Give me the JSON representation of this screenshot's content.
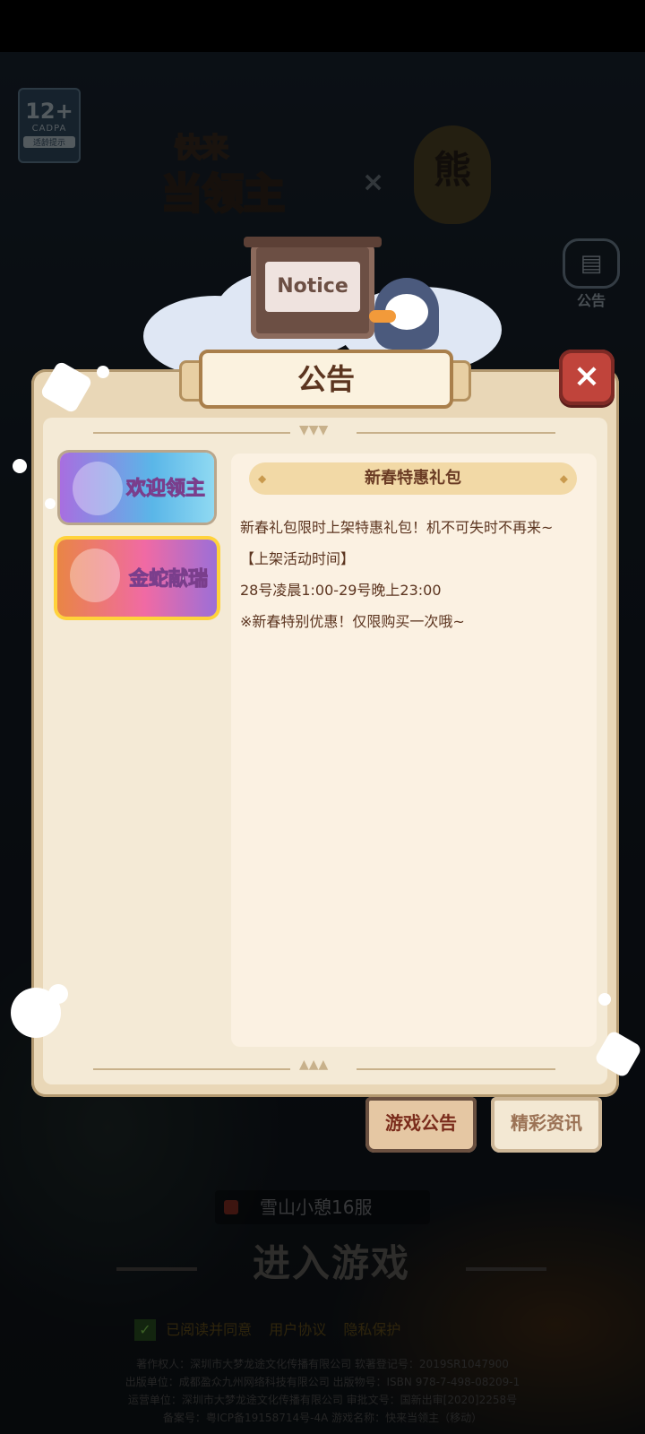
{
  "background": {
    "age_rating": {
      "age": "12+",
      "org": "CADPA",
      "note": "适龄提示"
    },
    "game_logo": {
      "line1": "快来",
      "line2": "当领主"
    },
    "x_mark": "×",
    "partner_logo": "熊",
    "side_notice_label": "公告",
    "server_name": "雪山小憩16服",
    "enter_game": "进入游戏",
    "agree": {
      "prefix": "已阅读并同意",
      "user_agreement": "用户协议",
      "privacy": "隐私保护"
    },
    "footer": [
      "著作权人：深圳市大梦龙途文化传播有限公司 软著登记号：2019SR1047900",
      "出版单位：成都盈众九州网络科技有限公司 出版物号：ISBN 978-7-498-08209-1",
      "运营单位：深圳市大梦龙途文化传播有限公司 审批文号：国新出审[2020]2258号",
      "备案号：粤ICP备19158714号-4A 游戏名称：快来当领主（移动）"
    ]
  },
  "dialog": {
    "sign_text": "Notice",
    "title": "公告",
    "close_icon": "×",
    "list": [
      {
        "label": "欢迎领主",
        "selected": false
      },
      {
        "label": "金蛇献瑞",
        "selected": true
      }
    ],
    "article": {
      "title": "新春特惠礼包",
      "lines": [
        "新春礼包限时上架特惠礼包！机不可失时不再来~",
        "【上架活动时间】",
        "28号凌晨1:00-29号晚上23:00",
        "※新春特别优惠！仅限购买一次哦~"
      ]
    },
    "tabs": [
      {
        "label": "游戏公告",
        "active": true
      },
      {
        "label": "精彩资讯",
        "active": false
      }
    ]
  },
  "colors": {
    "accent_gold": "#ffd23b",
    "close_red": "#c0443b",
    "text_brown": "#5c3520"
  }
}
